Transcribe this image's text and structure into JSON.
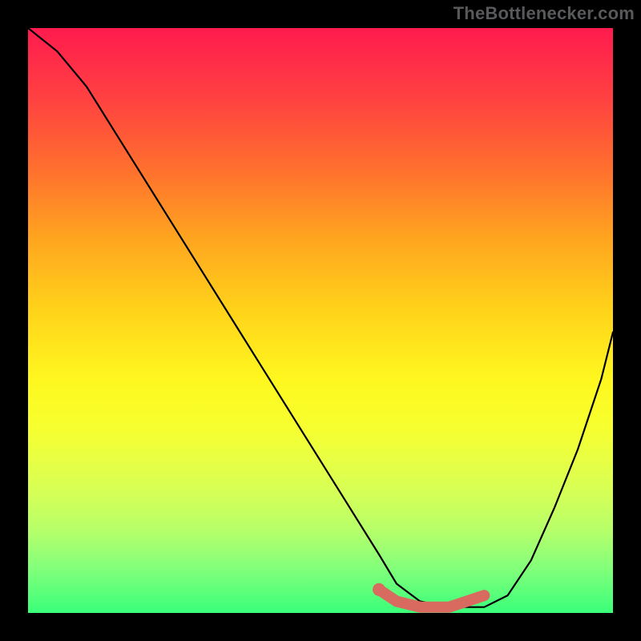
{
  "attribution": "TheBottlenecker.com",
  "chart_data": {
    "type": "line",
    "title": "",
    "xlabel": "",
    "ylabel": "",
    "xlim": [
      0,
      100
    ],
    "ylim": [
      0,
      100
    ],
    "series": [
      {
        "name": "bottleneck-curve",
        "x": [
          0,
          5,
          10,
          15,
          20,
          25,
          30,
          35,
          40,
          45,
          50,
          55,
          60,
          63,
          67,
          72,
          78,
          82,
          86,
          90,
          94,
          98,
          100
        ],
        "y": [
          100,
          96,
          90,
          82,
          74,
          66,
          58,
          50,
          42,
          34,
          26,
          18,
          10,
          5,
          2,
          1,
          1,
          3,
          9,
          18,
          28,
          40,
          48
        ]
      }
    ],
    "highlight": {
      "name": "optimal-range",
      "x": [
        60,
        63,
        67,
        72,
        78
      ],
      "y": [
        4,
        2,
        1,
        1,
        3
      ]
    },
    "gradient_colors": {
      "top": "#ff1b4e",
      "mid": "#ffe81f",
      "bottom": "#3aff7a"
    }
  }
}
